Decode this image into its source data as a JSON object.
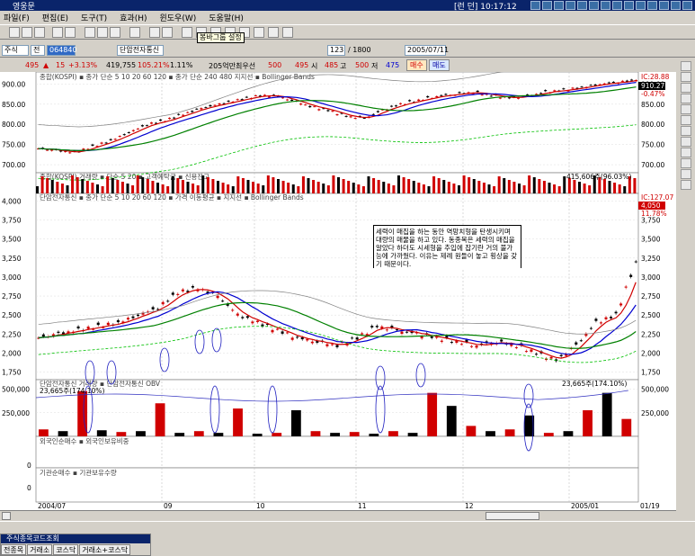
{
  "window": {
    "title": "영웅문",
    "clock": "[런 던] 10:17:12"
  },
  "menu": [
    "파일(F)",
    "편집(E)",
    "도구(T)",
    "효과(H)",
    "윈도우(W)",
    "도움말(H)"
  ],
  "tooltip": "봉바그룹 설정",
  "toolbar2": {
    "market": "주식",
    "mode": "전",
    "code": "064840",
    "name": "단암전자통신",
    "count": "123",
    "total": "/ 1800",
    "date": "2005/07/11"
  },
  "quote": {
    "price": "495",
    "change": "15",
    "pct": "+3.13%",
    "volume": "419,755",
    "ratio": "105.21%",
    "turn": "1.11%",
    "cap": "205억만",
    "prev_label": "최우선",
    "prev": "500",
    "close": "495",
    "open_label": "시",
    "open": "485",
    "high_label": "고",
    "high": "500",
    "low_label": "저",
    "low": "475",
    "buy": "매수",
    "sell": "매도"
  },
  "panels": {
    "kospi": {
      "legend": "종합(KOSPI) ▪ 종가 단순 5  10  20  60  120 ▪ 종가 단순 240  480  지지선 ▪ Bollinger Bands",
      "yticks": [
        "900.00",
        "850.00",
        "800.00",
        "750.00",
        "700.00"
      ],
      "rticks": [
        "900.00",
        "850.00",
        "800.00",
        "750.00",
        "700.00"
      ],
      "last": "IC:28.88",
      "last2": "910.27",
      "last3": "-0.47%"
    },
    "kvol": {
      "legend": "종합(KOSPI) 거래량 ▪ 단순 5  20 ▪ 고객예탁금 ▪ 신용잔고",
      "value": "415,606주(96.03%)"
    },
    "main": {
      "legend": "단암전자통신 ▪ 종가 단순 5  10  20  60  120 ▪ 가격 이동평균 ▪ 지지선 ▪ Bollinger Bands",
      "yticks": [
        "4,000",
        "3,750",
        "3,500",
        "3,250",
        "3,000",
        "2,750",
        "2,500",
        "2,250",
        "2,000",
        "1,750"
      ],
      "rticks": [
        "3,750",
        "3,500",
        "3,250",
        "3,000",
        "2,750",
        "2,500",
        "2,250",
        "2,000",
        "1,750"
      ],
      "last": "IC:127.07",
      "last2": "4,050",
      "last3": "11.78%",
      "note": "세력이 매집을 하는 동안 역망치형을 탄생시키며 대량의 매물을 하고 있다. 동종목은 세력의 매집을 알았다 하더도 시세형을 추입에 잡기란 거의 불가능에 가까웠다. 이유는 제례 원들이 놓고 횡상을 갖기 때문이다."
    },
    "mvol": {
      "legend": "단암전자통신 거래량 ▪ 단암전자통신 OBV",
      "yticks": [
        "500,000",
        "250,000"
      ],
      "rticks": [
        "500,000",
        "250,000"
      ],
      "value": "23,665주(174.10%)",
      "value2": "23,665주(174.10%)"
    },
    "foreign": {
      "legend": "외국인순매수 ▪ 외국인보유비중",
      "zero": "0"
    },
    "inst": {
      "legend": "기관순매수 ▪ 기관보유수량",
      "zero": "0"
    }
  },
  "xaxis": [
    "2004/07",
    "09",
    "10",
    "11",
    "12",
    "2005/01",
    "01/19"
  ],
  "codepanel": {
    "title": "주식종목코드조회",
    "tabs": [
      "전종목",
      "거래소",
      "코스닥",
      "거래소+코스닥"
    ]
  },
  "chart_data": [
    {
      "type": "line",
      "title": "종합(KOSPI)",
      "series": [
        {
          "name": "종가",
          "values": [
            740,
            735,
            730,
            745,
            760,
            780,
            800,
            810,
            825,
            840,
            850,
            860,
            870,
            872,
            860,
            845,
            835,
            820,
            815,
            835,
            850,
            860,
            870,
            875,
            880,
            872,
            865,
            870,
            880,
            885,
            892,
            900,
            905,
            910
          ]
        }
      ],
      "ylim": [
        680,
        930
      ]
    },
    {
      "type": "line",
      "title": "단암전자통신",
      "series": [
        {
          "name": "종가",
          "values": [
            2200,
            2250,
            2300,
            2350,
            2400,
            2500,
            2600,
            2800,
            2850,
            2750,
            2500,
            2400,
            2300,
            2200,
            2150,
            2100,
            2200,
            2350,
            2300,
            2250,
            2200,
            2150,
            2100,
            2150,
            2100,
            2000,
            1900,
            2100,
            2400,
            2500,
            3200
          ]
        }
      ],
      "ylim": [
        1650,
        4100
      ]
    },
    {
      "type": "bar",
      "title": "단암전자통신 거래량",
      "series": [
        {
          "name": "거래량",
          "values": [
            80,
            60,
            520,
            70,
            50,
            60,
            380,
            40,
            60,
            40,
            320,
            30,
            40,
            300,
            60,
            40,
            50,
            30,
            60,
            40,
            500,
            350,
            120,
            60,
            80,
            240,
            40,
            60,
            300,
            500,
            200
          ]
        }
      ],
      "ylim": [
        0,
        600
      ]
    }
  ]
}
